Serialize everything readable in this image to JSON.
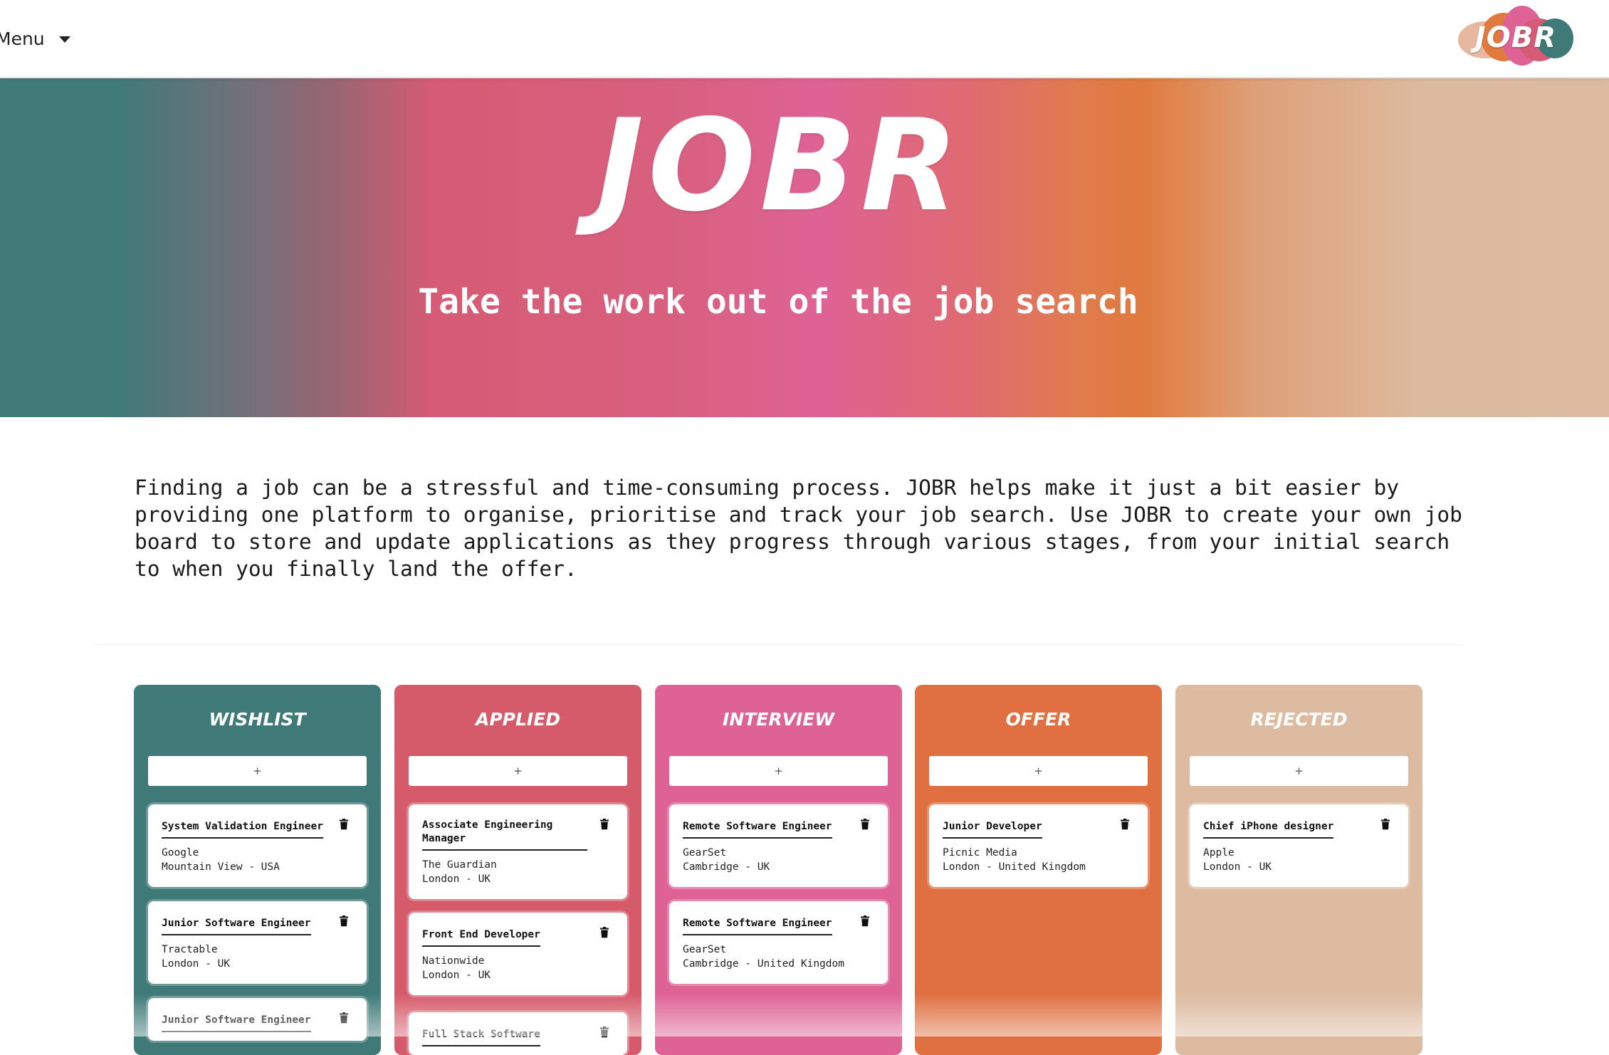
{
  "nav": {
    "menu_label": "Menu",
    "logo_text": "JOBR",
    "logo_colors": [
      "#e7b79f",
      "#e07a3e",
      "#de6294",
      "#d65b74",
      "#3f7a79"
    ]
  },
  "hero": {
    "title": "JOBR",
    "tagline": "Take the work out of the job search"
  },
  "intro": {
    "text": "Finding a job can be a stressful and time-consuming process. JOBR helps make it just a bit easier by providing one platform to organise, prioritise and track your job search. Use JOBR to create your own job board to store and update applications as they progress through various stages, from your initial search to when you finally land the offer."
  },
  "board": {
    "add_label": "+",
    "columns": [
      {
        "title": "WISHLIST",
        "color": "#3f7a79",
        "cards": [
          {
            "title": "System Validation Engineer",
            "company": "Google",
            "location": "Mountain View - USA"
          },
          {
            "title": "Junior Software Engineer",
            "company": "Tractable",
            "location": "London - UK"
          },
          {
            "title": "Junior Software Engineer",
            "company": "",
            "location": ""
          }
        ]
      },
      {
        "title": "APPLIED",
        "color": "#d65b6a",
        "cards": [
          {
            "title": "Associate Engineering Manager",
            "company": "The Guardian",
            "location": "London - UK"
          },
          {
            "title": "Front End Developer",
            "company": "Nationwide",
            "location": "London - UK"
          },
          {
            "title": "Full Stack Software",
            "company": "",
            "location": ""
          }
        ]
      },
      {
        "title": "INTERVIEW",
        "color": "#de6294",
        "cards": [
          {
            "title": "Remote Software Engineer",
            "company": "GearSet",
            "location": "Cambridge - UK"
          },
          {
            "title": "Remote Software Engineer",
            "company": "GearSet",
            "location": "Cambridge - United Kingdom"
          }
        ]
      },
      {
        "title": "OFFER",
        "color": "#e07042",
        "cards": [
          {
            "title": "Junior Developer",
            "company": "Picnic Media",
            "location": "London - United Kingdom"
          }
        ]
      },
      {
        "title": "REJECTED",
        "color": "#dcbba0",
        "cards": [
          {
            "title": "Chief iPhone designer",
            "company": "Apple",
            "location": "London - UK"
          }
        ]
      }
    ]
  }
}
